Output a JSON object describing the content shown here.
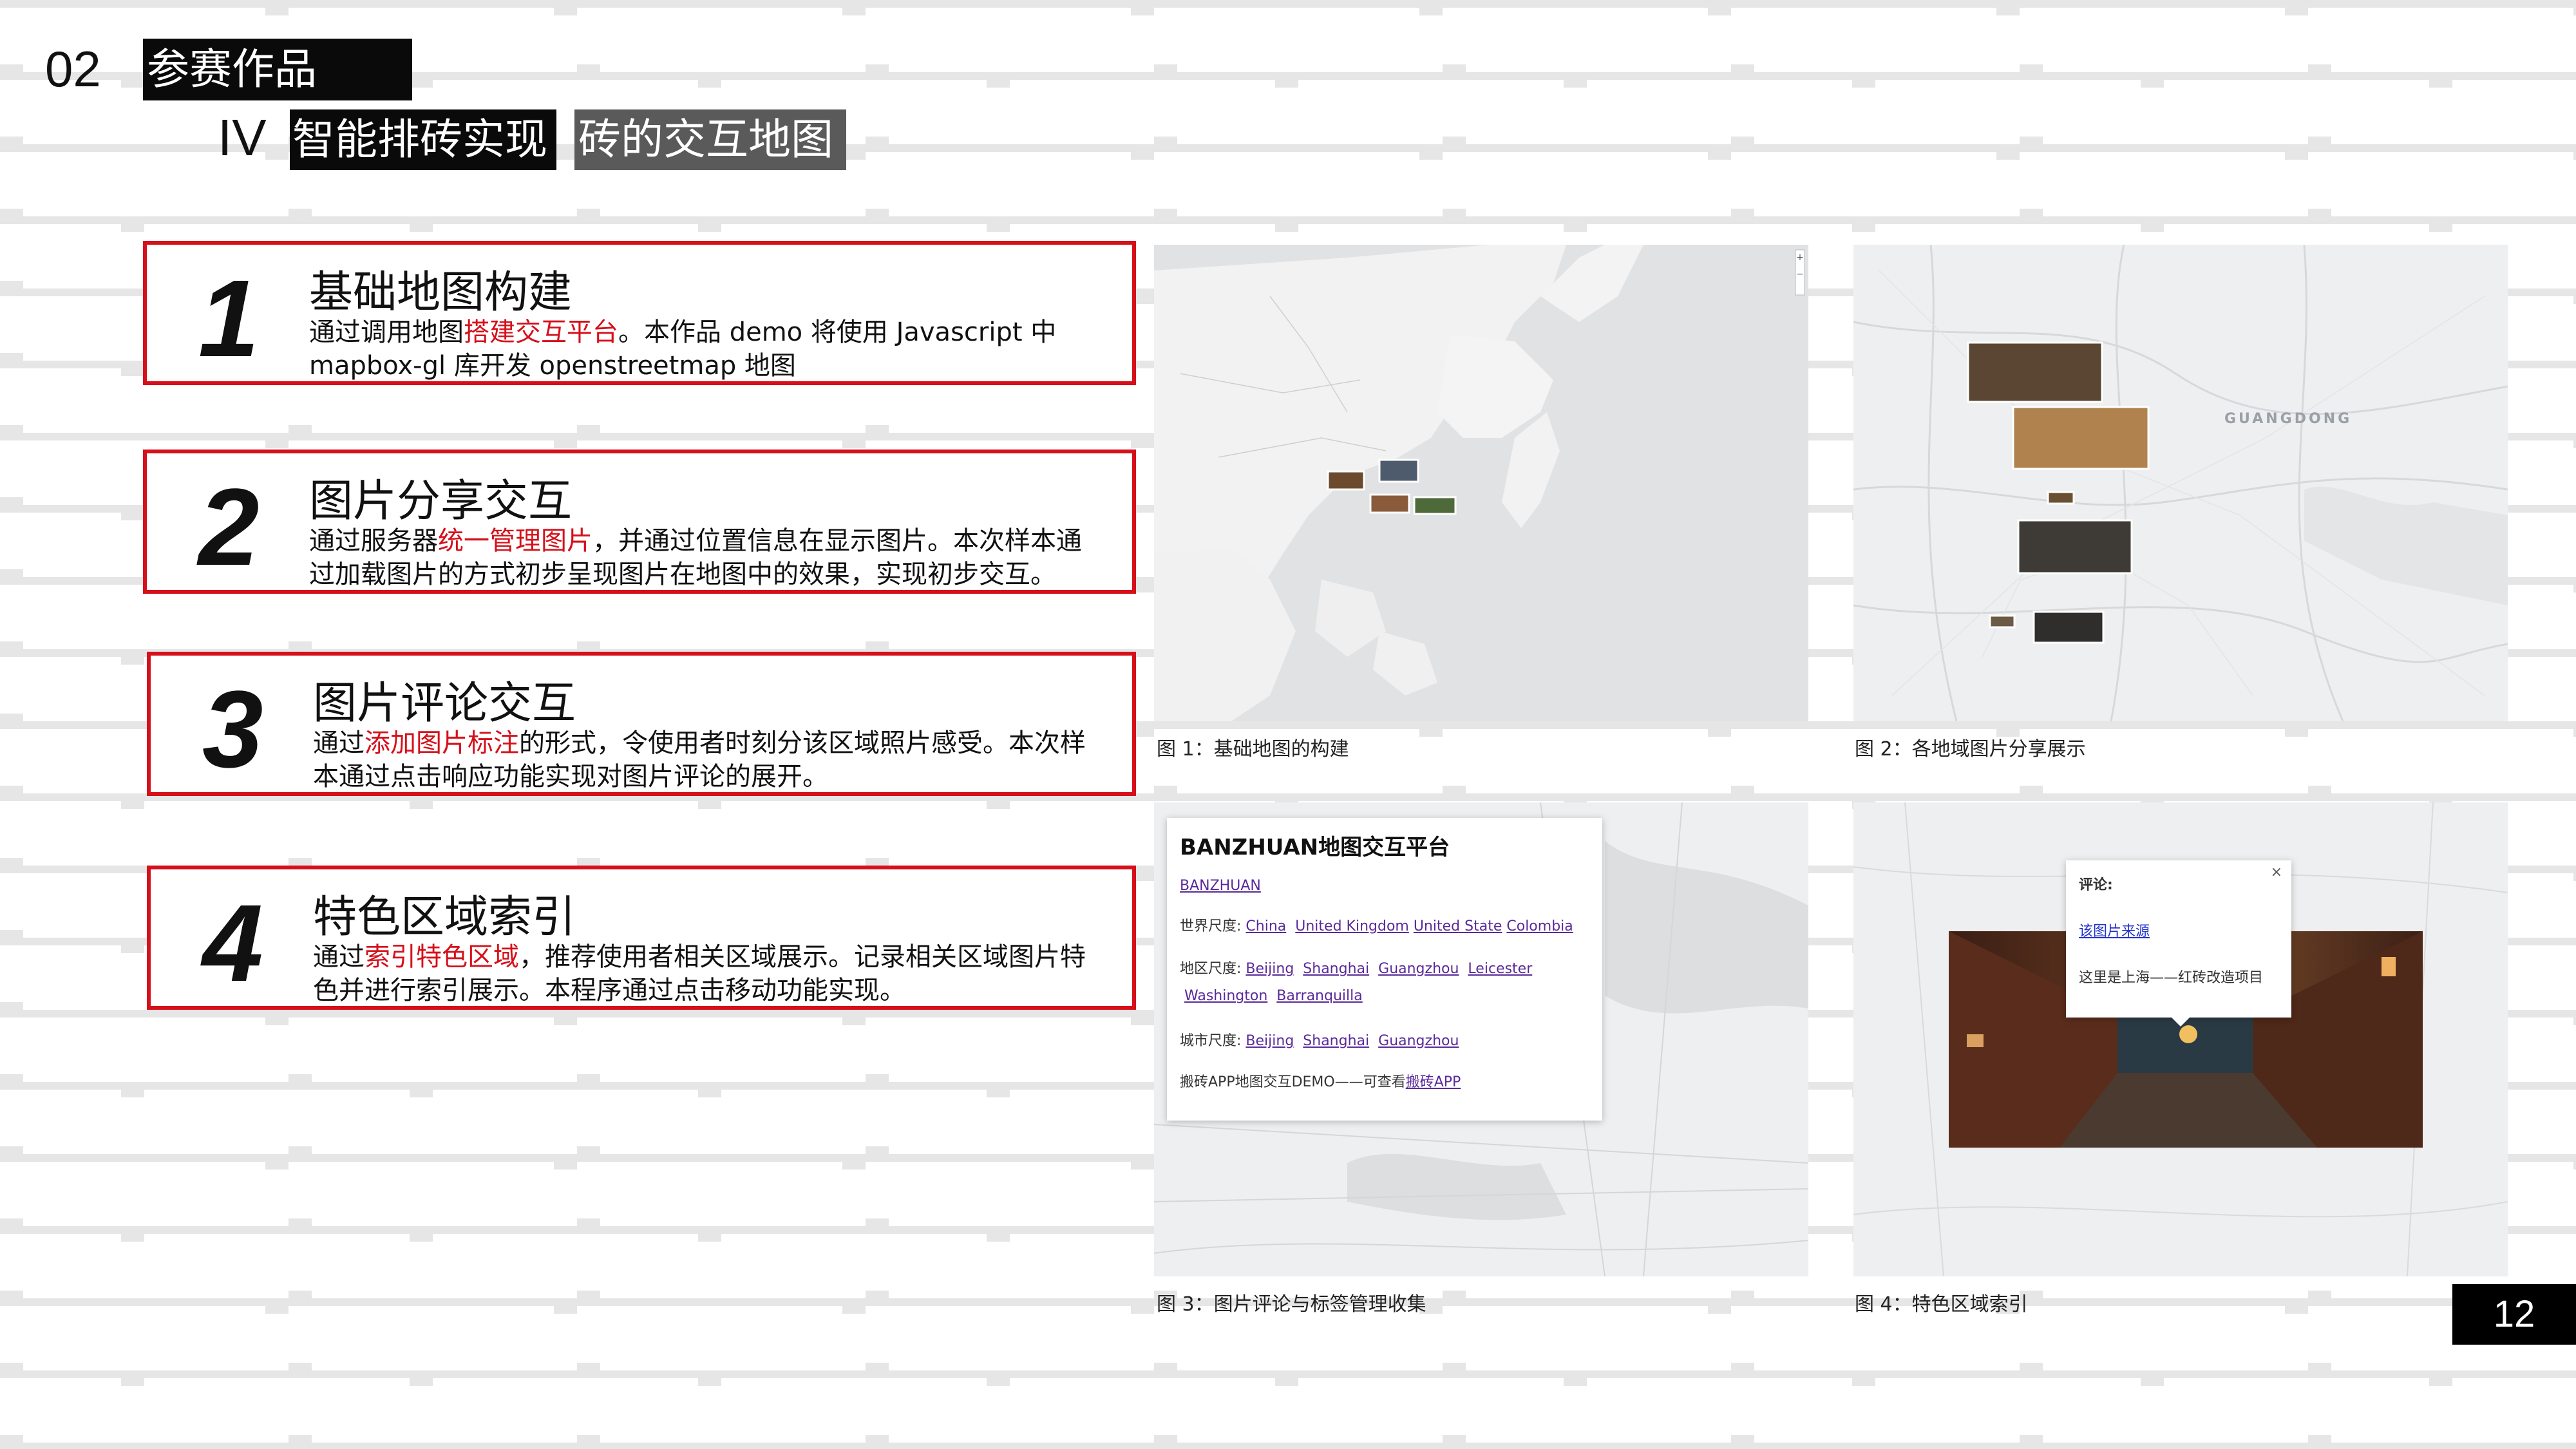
{
  "header": {
    "section_number": "02",
    "section_title": "参赛作品",
    "roman": "IV",
    "tab_active": "智能排砖实现",
    "tab_secondary": "砖的交互地图"
  },
  "cards": [
    {
      "number": "1",
      "title": "基础地图构建",
      "desc_pre": "通过调用地图",
      "desc_hl": "搭建交互平台",
      "desc_post": "。本作品 demo 将使用 Javascript 中 mapbox-gl 库开发 openstreetmap 地图"
    },
    {
      "number": "2",
      "title": "图片分享交互",
      "desc_pre": "通过服务器",
      "desc_hl": "统一管理图片",
      "desc_post": "，并通过位置信息在显示图片。本次样本通过加载图片的方式初步呈现图片在地图中的效果，实现初步交互。"
    },
    {
      "number": "3",
      "title": "图片评论交互",
      "desc_pre": "通过",
      "desc_hl": "添加图片标注",
      "desc_post": "的形式，令使用者时刻分该区域照片感受。本次样本通过点击响应功能实现对图片评论的展开。"
    },
    {
      "number": "4",
      "title": "特色区域索引",
      "desc_pre": "通过",
      "desc_hl": "索引特色区域",
      "desc_post": "，推荐使用者相关区域展示。记录相关区域图片特色并进行索引展示。本程序通过点击移动功能实现。"
    }
  ],
  "figures": [
    {
      "caption": "图 1：基础地图的构建"
    },
    {
      "caption": "图 2：各地域图片分享展示",
      "map_label": "GUANGDONG"
    },
    {
      "caption": "图 3：图片评论与标签管理收集",
      "popup": {
        "title": "BANZHUAN地图交互平台",
        "link": "BANZHUAN",
        "world_label": "世界尺度:",
        "world_links": [
          "China",
          "United Kingdom",
          "United State",
          "Colombia"
        ],
        "region_label": "地区尺度:",
        "region_links": [
          "Beijing",
          "Shanghai",
          "Guangzhou",
          "Leicester",
          "Washington",
          "Barranquilla"
        ],
        "city_label": "城市尺度:",
        "city_links": [
          "Beijing",
          "Shanghai",
          "Guangzhou"
        ],
        "footer_text": "搬砖APP地图交互DEMO——可查看",
        "footer_link": "搬砖APP"
      }
    },
    {
      "caption": "图 4：特色区域索引",
      "popup": {
        "label": "评论:",
        "link": "该图片来源",
        "text": "这里是上海——红砖改造项目",
        "close": "×"
      }
    }
  ],
  "page_number": "12",
  "colors": {
    "accent": "#d6101a",
    "dark": "#0a0a0a",
    "tab_gray": "#5a5a5a"
  }
}
